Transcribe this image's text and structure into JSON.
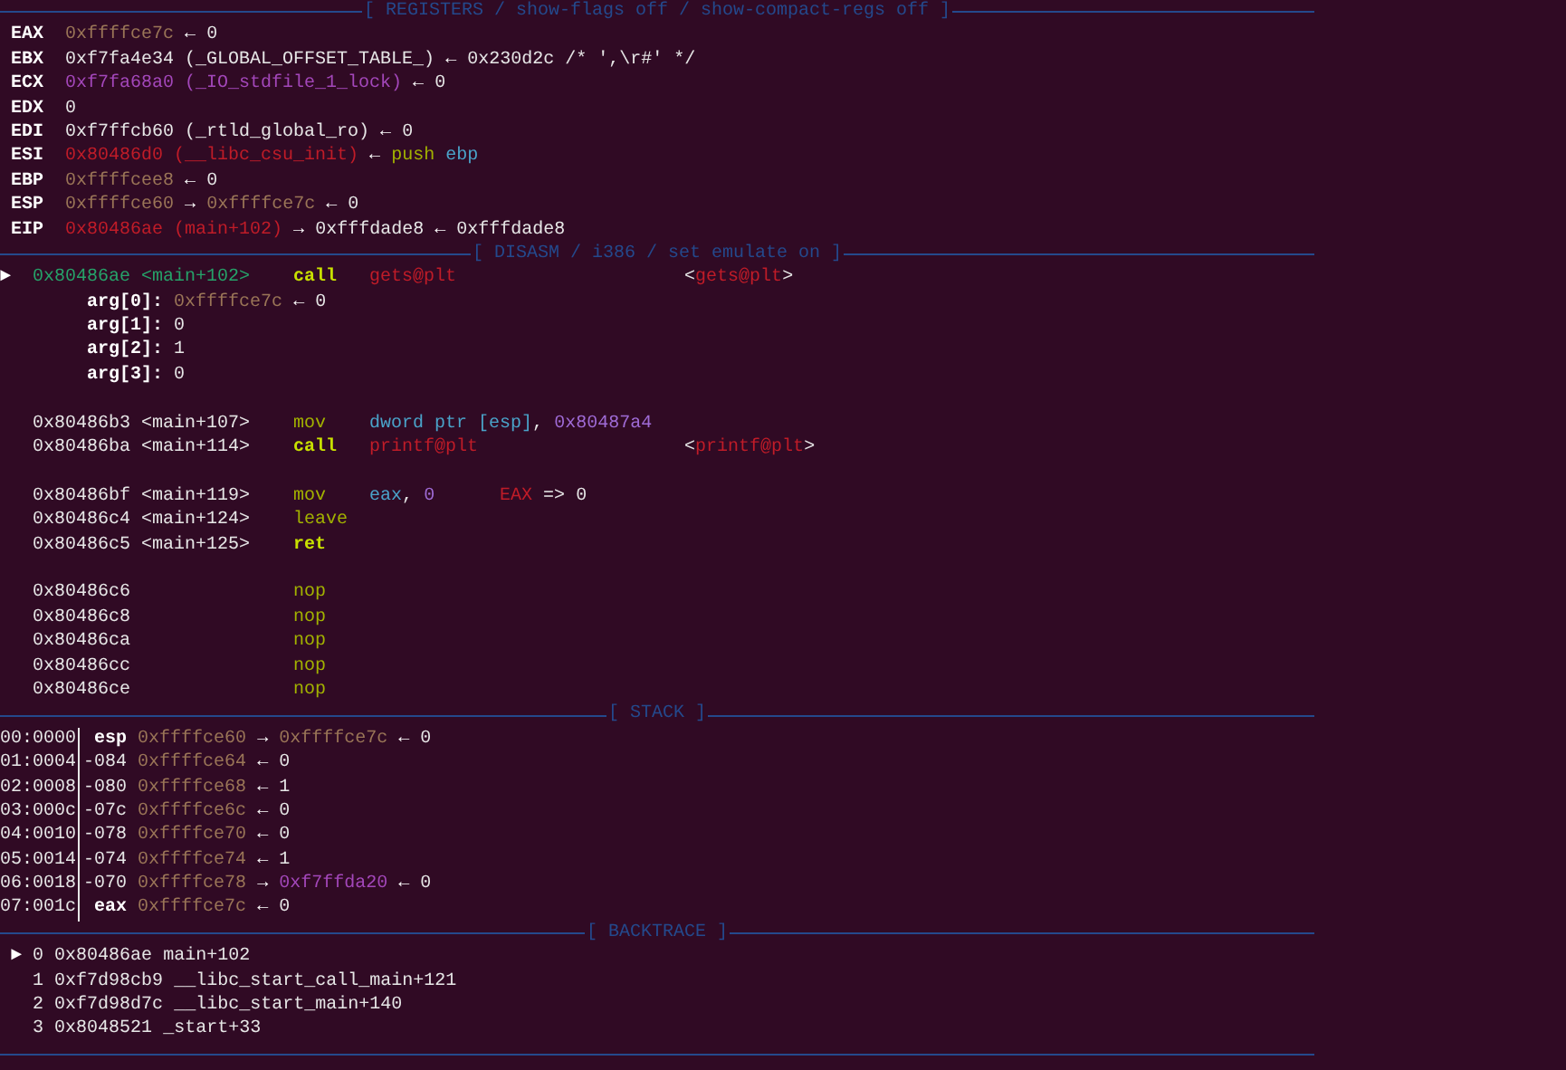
{
  "registers": {
    "title": "[ REGISTERS / show-flags off / show-compact-regs off ]",
    "rows": [
      {
        "name": "EAX",
        "value": [
          {
            "text": "0xffffce7c",
            "kind": "stack"
          },
          {
            "text": "←",
            "kind": "arrow"
          },
          {
            "text": "0",
            "kind": "plain"
          }
        ]
      },
      {
        "name": "EBX",
        "value": [
          {
            "text": "0xf7fa4e34 (_GLOBAL_OFFSET_TABLE_)",
            "kind": "plain"
          },
          {
            "text": "←",
            "kind": "arrow"
          },
          {
            "text": "0x230d2c /* ',\\r#' */",
            "kind": "plain"
          }
        ]
      },
      {
        "name": "ECX",
        "value": [
          {
            "text": "0xf7fa68a0 (_IO_stdfile_1_lock)",
            "kind": "data"
          },
          {
            "text": "←",
            "kind": "arrow"
          },
          {
            "text": "0",
            "kind": "plain"
          }
        ]
      },
      {
        "name": "EDX",
        "value": [
          {
            "text": "0",
            "kind": "plain"
          }
        ]
      },
      {
        "name": "EDI",
        "value": [
          {
            "text": "0xf7ffcb60 (_rtld_global_ro)",
            "kind": "plain"
          },
          {
            "text": "←",
            "kind": "arrow"
          },
          {
            "text": "0",
            "kind": "plain"
          }
        ]
      },
      {
        "name": "ESI",
        "value": [
          {
            "text": "0x80486d0 (__libc_csu_init)",
            "kind": "code"
          },
          {
            "text": "←",
            "kind": "arrow"
          },
          {
            "text": "push",
            "kind": "mnemonic"
          },
          {
            "text": "ebp",
            "kind": "register"
          }
        ]
      },
      {
        "name": "EBP",
        "value": [
          {
            "text": "0xffffcee8",
            "kind": "stack"
          },
          {
            "text": "←",
            "kind": "arrow"
          },
          {
            "text": "0",
            "kind": "plain"
          }
        ]
      },
      {
        "name": "ESP",
        "value": [
          {
            "text": "0xffffce60",
            "kind": "stack"
          },
          {
            "text": "→",
            "kind": "arrow"
          },
          {
            "text": "0xffffce7c",
            "kind": "stack"
          },
          {
            "text": "←",
            "kind": "arrow"
          },
          {
            "text": "0",
            "kind": "plain"
          }
        ]
      },
      {
        "name": "EIP",
        "value": [
          {
            "text": "0x80486ae (main+102)",
            "kind": "code"
          },
          {
            "text": "→",
            "kind": "arrow"
          },
          {
            "text": "0xfffdade8",
            "kind": "plain"
          },
          {
            "text": "←",
            "kind": "arrow"
          },
          {
            "text": "0xfffdade8",
            "kind": "plain"
          }
        ]
      }
    ]
  },
  "disasm": {
    "title": "[ DISASM / i386 / set emulate on ]",
    "instructions": [
      {
        "current": true,
        "marker": "►",
        "address": "0x80486ae",
        "symbol": "<main+102>",
        "mnemonic": {
          "text": "call",
          "kind": "mnemonic-strong"
        },
        "operands": [
          {
            "text": "gets@plt",
            "kind": "code"
          }
        ],
        "target": [
          {
            "text": "<",
            "kind": "plain"
          },
          {
            "text": "gets@plt",
            "kind": "code",
            "attached": true
          },
          {
            "text": ">",
            "kind": "plain",
            "attached": true
          }
        ],
        "args": [
          [
            {
              "text": "arg[0]:",
              "kind": "bold"
            },
            {
              "text": "0xffffce7c",
              "kind": "stack"
            },
            {
              "text": "←",
              "kind": "arrow"
            },
            {
              "text": "0",
              "kind": "plain"
            }
          ],
          [
            {
              "text": "arg[1]:",
              "kind": "bold"
            },
            {
              "text": "0",
              "kind": "plain"
            }
          ],
          [
            {
              "text": "arg[2]:",
              "kind": "bold"
            },
            {
              "text": "1",
              "kind": "plain"
            }
          ],
          [
            {
              "text": "arg[3]:",
              "kind": "bold"
            },
            {
              "text": "0",
              "kind": "plain"
            }
          ]
        ]
      },
      {
        "current": false,
        "blank_before": true,
        "address": "0x80486b3",
        "symbol": "<main+107>",
        "mnemonic": {
          "text": "mov",
          "kind": "mnemonic"
        },
        "operands": [
          {
            "text": "dword ptr [esp]",
            "kind": "register"
          },
          {
            "text": ",",
            "kind": "plain",
            "attached": true
          },
          {
            "text": "0x80487a4",
            "kind": "number"
          }
        ]
      },
      {
        "current": false,
        "address": "0x80486ba",
        "symbol": "<main+114>",
        "mnemonic": {
          "text": "call",
          "kind": "mnemonic-strong"
        },
        "operands": [
          {
            "text": "printf@plt",
            "kind": "code"
          }
        ],
        "target": [
          {
            "text": "<",
            "kind": "plain"
          },
          {
            "text": "printf@plt",
            "kind": "code",
            "attached": true
          },
          {
            "text": ">",
            "kind": "plain",
            "attached": true
          }
        ]
      },
      {
        "current": false,
        "blank_before": true,
        "address": "0x80486bf",
        "symbol": "<main+119>",
        "mnemonic": {
          "text": "mov",
          "kind": "mnemonic"
        },
        "operands": [
          {
            "text": "eax",
            "kind": "register"
          },
          {
            "text": ",",
            "kind": "plain",
            "attached": true
          },
          {
            "text": "0",
            "kind": "number"
          }
        ],
        "comment": [
          {
            "text": "EAX",
            "kind": "code"
          },
          {
            "text": "=>",
            "kind": "plain"
          },
          {
            "text": "0",
            "kind": "plain"
          }
        ]
      },
      {
        "current": false,
        "address": "0x80486c4",
        "symbol": "<main+124>",
        "mnemonic": {
          "text": "leave",
          "kind": "mnemonic"
        }
      },
      {
        "current": false,
        "address": "0x80486c5",
        "symbol": "<main+125>",
        "mnemonic": {
          "text": "ret",
          "kind": "mnemonic-strong"
        }
      },
      {
        "current": false,
        "blank_before": true,
        "address": "0x80486c6",
        "mnemonic": {
          "text": "nop",
          "kind": "mnemonic"
        }
      },
      {
        "current": false,
        "address": "0x80486c8",
        "mnemonic": {
          "text": "nop",
          "kind": "mnemonic"
        }
      },
      {
        "current": false,
        "address": "0x80486ca",
        "mnemonic": {
          "text": "nop",
          "kind": "mnemonic"
        }
      },
      {
        "current": false,
        "address": "0x80486cc",
        "mnemonic": {
          "text": "nop",
          "kind": "mnemonic"
        }
      },
      {
        "current": false,
        "address": "0x80486ce",
        "mnemonic": {
          "text": "nop",
          "kind": "mnemonic"
        }
      }
    ]
  },
  "stack": {
    "title": "[ STACK ]",
    "rows": [
      {
        "index": "00:0000",
        "offset": {
          "text": "esp",
          "kind": "bold"
        },
        "value": [
          {
            "text": "0xffffce60",
            "kind": "stack"
          },
          {
            "text": "→",
            "kind": "arrow"
          },
          {
            "text": "0xffffce7c",
            "kind": "stack"
          },
          {
            "text": "←",
            "kind": "arrow"
          },
          {
            "text": "0",
            "kind": "plain"
          }
        ]
      },
      {
        "index": "01:0004",
        "offset": {
          "text": "-084",
          "kind": "plain"
        },
        "value": [
          {
            "text": "0xffffce64",
            "kind": "stack"
          },
          {
            "text": "←",
            "kind": "arrow"
          },
          {
            "text": "0",
            "kind": "plain"
          }
        ]
      },
      {
        "index": "02:0008",
        "offset": {
          "text": "-080",
          "kind": "plain"
        },
        "value": [
          {
            "text": "0xffffce68",
            "kind": "stack"
          },
          {
            "text": "←",
            "kind": "arrow"
          },
          {
            "text": "1",
            "kind": "plain"
          }
        ]
      },
      {
        "index": "03:000c",
        "offset": {
          "text": "-07c",
          "kind": "plain"
        },
        "value": [
          {
            "text": "0xffffce6c",
            "kind": "stack"
          },
          {
            "text": "←",
            "kind": "arrow"
          },
          {
            "text": "0",
            "kind": "plain"
          }
        ]
      },
      {
        "index": "04:0010",
        "offset": {
          "text": "-078",
          "kind": "plain"
        },
        "value": [
          {
            "text": "0xffffce70",
            "kind": "stack"
          },
          {
            "text": "←",
            "kind": "arrow"
          },
          {
            "text": "0",
            "kind": "plain"
          }
        ]
      },
      {
        "index": "05:0014",
        "offset": {
          "text": "-074",
          "kind": "plain"
        },
        "value": [
          {
            "text": "0xffffce74",
            "kind": "stack"
          },
          {
            "text": "←",
            "kind": "arrow"
          },
          {
            "text": "1",
            "kind": "plain"
          }
        ]
      },
      {
        "index": "06:0018",
        "offset": {
          "text": "-070",
          "kind": "plain"
        },
        "value": [
          {
            "text": "0xffffce78",
            "kind": "stack"
          },
          {
            "text": "→",
            "kind": "arrow"
          },
          {
            "text": "0xf7ffda20",
            "kind": "data"
          },
          {
            "text": "←",
            "kind": "arrow"
          },
          {
            "text": "0",
            "kind": "plain"
          }
        ]
      },
      {
        "index": "07:001c",
        "offset": {
          "text": "eax",
          "kind": "bold"
        },
        "value": [
          {
            "text": "0xffffce7c",
            "kind": "stack"
          },
          {
            "text": "←",
            "kind": "arrow"
          },
          {
            "text": "0",
            "kind": "plain"
          }
        ]
      }
    ]
  },
  "backtrace": {
    "title": "[ BACKTRACE ]",
    "frames": [
      {
        "marker": "►",
        "frame": "0",
        "address": "0x80486ae",
        "symbol": "main+102"
      },
      {
        "frame": "1",
        "address": "0xf7d98cb9",
        "symbol": "__libc_start_call_main+121"
      },
      {
        "frame": "2",
        "address": "0xf7d98d7c",
        "symbol": "__libc_start_main+140"
      },
      {
        "frame": "3",
        "address": "0x8048521",
        "symbol": "_start+33"
      }
    ]
  }
}
